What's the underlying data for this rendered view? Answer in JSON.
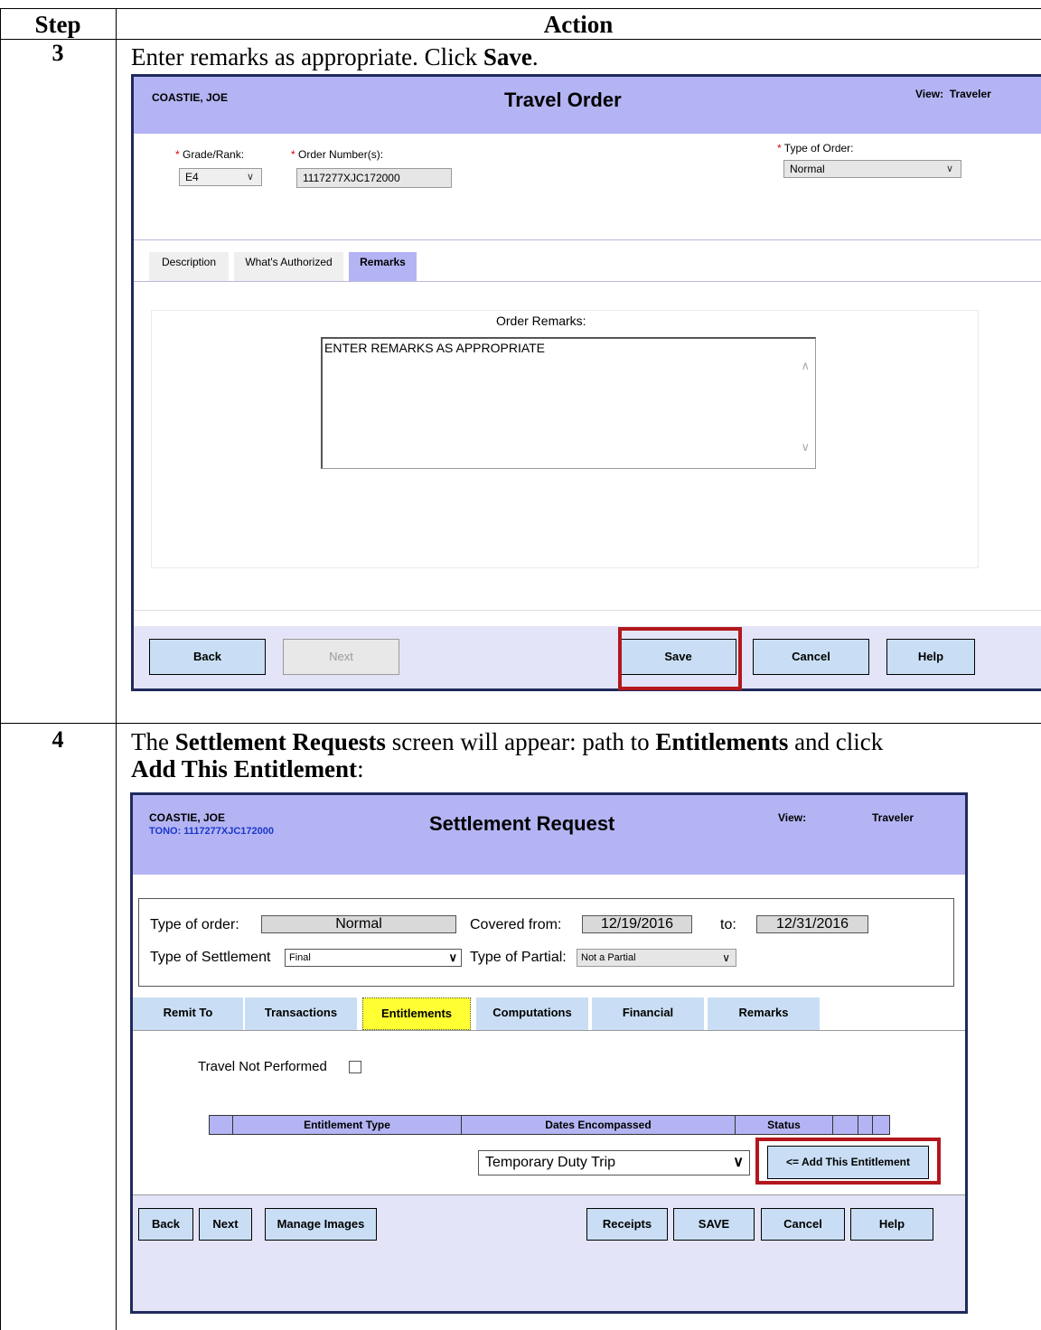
{
  "table": {
    "header_step": "Step",
    "header_action": "Action"
  },
  "step3": {
    "number": "3",
    "instruction_pre": "Enter remarks as appropriate.  Click ",
    "instruction_bold": "Save",
    "instruction_post": ".",
    "screen": {
      "user_name": "COASTIE, JOE",
      "title": "Travel Order",
      "view_label": "View:",
      "view_value": "Traveler",
      "grade_label": "Grade/Rank:",
      "grade_value": "E4",
      "order_number_label": "Order Number(s):",
      "order_number_value": "1117277XJC172000",
      "type_of_order_label": "Type of Order:",
      "type_of_order_value": "Normal",
      "required_mark": "*",
      "tabs": [
        {
          "label": "Description"
        },
        {
          "label": "What's Authorized"
        },
        {
          "label": "Remarks"
        }
      ],
      "remarks_label": "Order Remarks:",
      "remarks_value": "ENTER REMARKS AS APPROPRIATE",
      "buttons": {
        "back": "Back",
        "next": "Next",
        "save": "Save",
        "cancel": "Cancel",
        "help": "Help"
      }
    }
  },
  "step4": {
    "number": "4",
    "instruction_line1_a": "The ",
    "instruction_line1_b": "Settlement Requests",
    "instruction_line1_c": " screen will appear:  path to ",
    "instruction_line1_d": "Entitlements",
    "instruction_line1_e": " and click",
    "instruction_line2_a": "Add This Entitlement",
    "instruction_line2_b": ":",
    "screen": {
      "user_name": "COASTIE, JOE",
      "tono": "TONO: 1117277XJC172000",
      "title": "Settlement Request",
      "view_label": "View:",
      "view_value": "Traveler",
      "type_of_order_label": "Type of order:",
      "type_of_order_value": "Normal",
      "covered_from_label": "Covered from:",
      "covered_from_value": "12/19/2016",
      "to_label": "to:",
      "to_value": "12/31/2016",
      "type_settlement_label": "Type of Settlement",
      "type_settlement_value": "Final",
      "type_partial_label": "Type of Partial:",
      "type_partial_value": "Not a Partial",
      "tabs": [
        {
          "label": "Remit To"
        },
        {
          "label": "Transactions"
        },
        {
          "label": "Entitlements"
        },
        {
          "label": "Computations"
        },
        {
          "label": "Financial"
        },
        {
          "label": "Remarks"
        }
      ],
      "travel_not_performed": "Travel Not Performed",
      "columns": [
        "Entitlement Type",
        "Dates Encompassed",
        "Status"
      ],
      "entitlement_select": "Temporary Duty Trip",
      "add_button": "<= Add This Entitlement",
      "buttons": {
        "back": "Back",
        "next": "Next",
        "manage_images": "Manage Images",
        "receipts": "Receipts",
        "save": "SAVE",
        "cancel": "Cancel",
        "help": "Help"
      }
    }
  },
  "colors": {
    "header_purple": "#b4b4f4",
    "footer_lavender": "#e4e4f8",
    "button_blue": "#c9def4",
    "highlight_yellow": "#ffff33",
    "red_highlight": "#b3171d",
    "frame_navy": "#1f2a5c",
    "tono_blue": "#1a37c8"
  },
  "icons": [
    "chevron-down-icon",
    "scroll-up-icon",
    "scroll-down-icon",
    "checkbox-icon"
  ]
}
